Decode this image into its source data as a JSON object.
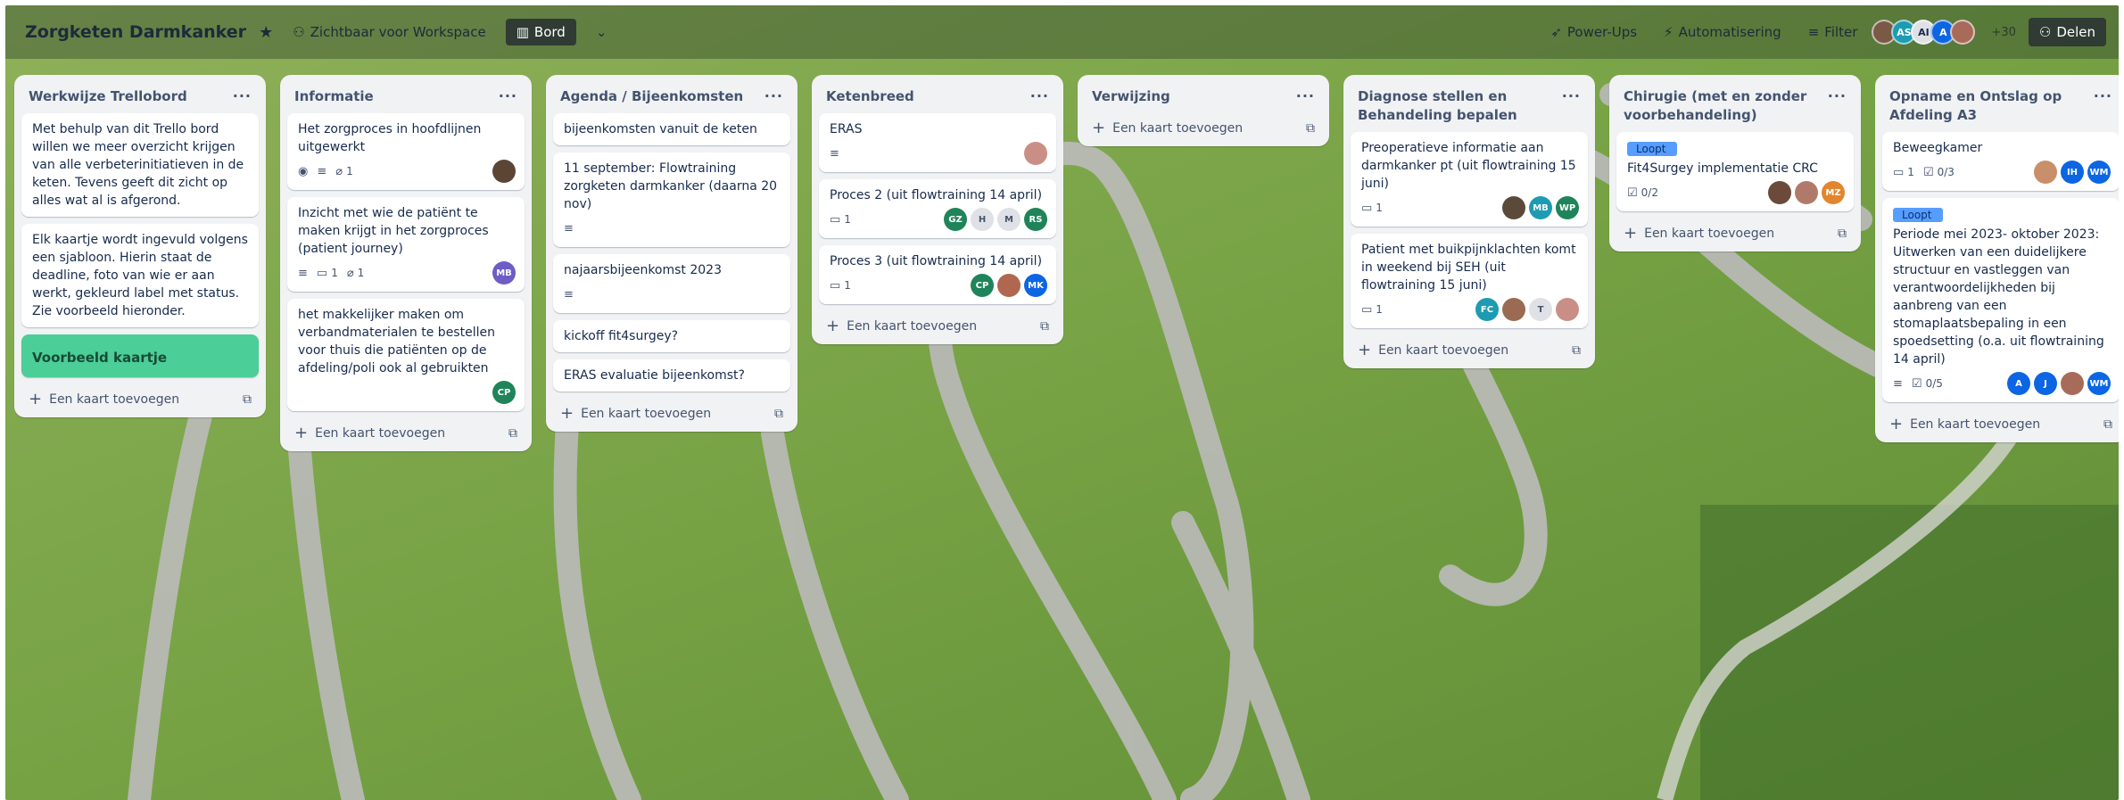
{
  "header": {
    "title": "Zorgketen Darmkanker",
    "visibility": "Zichtbaar voor Workspace",
    "view": "Bord",
    "powerups": "Power-Ups",
    "automation": "Automatisering",
    "filter": "Filter",
    "more_members": "+30",
    "share": "Delen",
    "avatars": [
      {
        "initials": "",
        "color": "#7a5a46"
      },
      {
        "initials": "AS",
        "color": "#1d9bb2"
      },
      {
        "initials": "AI",
        "color": "#dfe1e6"
      },
      {
        "initials": "A",
        "color": "#0c66e4"
      },
      {
        "initials": "",
        "color": "#a86b5a"
      }
    ]
  },
  "add_card_label": "Een kaart toevoegen",
  "lists": [
    {
      "title": "Werkwijze Trellobord",
      "cards": [
        {
          "title": "Met behulp van dit Trello bord willen we meer overzicht krijgen van alle verbeterinitiatieven in de keten. Tevens geeft dit zicht op alles wat al is afgerond."
        },
        {
          "title": "Elk kaartje wordt ingevuld volgens een sjabloon. Hierin staat de deadline, foto van wie er aan werkt, gekleurd label met status. Zie voorbeeld hieronder."
        },
        {
          "title": "Voorbeeld kaartje",
          "green": true
        }
      ]
    },
    {
      "title": "Informatie",
      "cards": [
        {
          "title": "Het zorgproces in hoofdlijnen uitgewerkt",
          "watch": true,
          "desc": true,
          "attach": "1",
          "avatars": [
            {
              "i": "",
              "c": "#5b4636"
            }
          ]
        },
        {
          "title": "Inzicht met wie de patiënt te maken krijgt in het zorgproces (patient journey)",
          "desc": true,
          "comments": "1",
          "attach": "1",
          "avatars": [
            {
              "i": "MB",
              "c": "#6e5dc6"
            }
          ]
        },
        {
          "title": "het makkelijker maken om verbandmaterialen te bestellen voor thuis die patiënten op de afdeling/poli ook al gebruikten",
          "avatars": [
            {
              "i": "CP",
              "c": "#1f845a"
            }
          ]
        }
      ]
    },
    {
      "title": "Agenda / Bijeenkomsten",
      "cards": [
        {
          "title": "bijeenkomsten vanuit de keten"
        },
        {
          "title": "11 september: Flowtraining zorgketen darmkanker (daarna 20 nov)",
          "desc": true
        },
        {
          "title": "najaarsbijeenkomst 2023",
          "desc": true
        },
        {
          "title": "kickoff fit4surgey?"
        },
        {
          "title": "ERAS evaluatie bijeenkomst?"
        }
      ]
    },
    {
      "title": "Ketenbreed",
      "cards": [
        {
          "title": "ERAS",
          "desc": true,
          "avatars": [
            {
              "i": "",
              "c": "#c98f86"
            }
          ]
        },
        {
          "title": "Proces 2 (uit flowtraining 14 april)",
          "comments": "1",
          "avatars": [
            {
              "i": "GZ",
              "c": "#1f845a"
            },
            {
              "i": "H",
              "c": "#dfe1e6"
            },
            {
              "i": "M",
              "c": "#dfe1e6"
            },
            {
              "i": "RS",
              "c": "#1f845a"
            }
          ]
        },
        {
          "title": "Proces 3 (uit flowtraining 14 april)",
          "comments": "1",
          "avatars": [
            {
              "i": "CP",
              "c": "#1f845a"
            },
            {
              "i": "",
              "c": "#b0664f"
            },
            {
              "i": "MK",
              "c": "#0c66e4"
            }
          ]
        }
      ]
    },
    {
      "title": "Verwijzing",
      "cards": []
    },
    {
      "title": "Diagnose stellen en Behandeling bepalen",
      "cards": [
        {
          "title": "Preoperatieve informatie aan darmkanker pt (uit flowtraining 15 juni)",
          "comments": "1",
          "avatars": [
            {
              "i": "",
              "c": "#5b4a3a"
            },
            {
              "i": "MB",
              "c": "#1d9bb2"
            },
            {
              "i": "WP",
              "c": "#1f845a"
            }
          ]
        },
        {
          "title": "Patient met buikpijnklachten komt in weekend bij SEH (uit flowtraining 15 juni)",
          "comments": "1",
          "avatars": [
            {
              "i": "FC",
              "c": "#1d9bb2"
            },
            {
              "i": "",
              "c": "#9a6a52"
            },
            {
              "i": "T",
              "c": "#dfe1e6"
            },
            {
              "i": "",
              "c": "#c98f86"
            }
          ]
        }
      ]
    },
    {
      "title": "Chirugie (met en zonder voorbehandeling)",
      "cards": [
        {
          "title": "Fit4Surgey implementatie CRC",
          "label": "Loopt",
          "checklist": "0/2",
          "avatars": [
            {
              "i": "",
              "c": "#6b4a3a"
            },
            {
              "i": "",
              "c": "#b07a6a"
            },
            {
              "i": "MZ",
              "c": "#e2852e"
            }
          ]
        }
      ]
    },
    {
      "title": "Opname en Ontslag op Afdeling A3",
      "cards": [
        {
          "title": "Beweegkamer",
          "comments": "1",
          "checklist": "0/3",
          "avatars": [
            {
              "i": "",
              "c": "#c98f6a"
            },
            {
              "i": "IH",
              "c": "#0c66e4"
            },
            {
              "i": "WM",
              "c": "#0c66e4"
            }
          ]
        },
        {
          "title": "Periode mei 2023- oktober 2023: Uitwerken van een duidelijkere structuur en vastleggen van verantwoordelijkheden bij aanbreng van een stomaplaatsbepaling in een spoedsetting (o.a. uit flowtraining 14 april)",
          "label": "Loopt",
          "desc": true,
          "checklist": "0/5",
          "avatars": [
            {
              "i": "A",
              "c": "#0c66e4"
            },
            {
              "i": "J",
              "c": "#0c66e4"
            },
            {
              "i": "",
              "c": "#a86b5a"
            },
            {
              "i": "WM",
              "c": "#0c66e4"
            }
          ]
        }
      ]
    }
  ]
}
